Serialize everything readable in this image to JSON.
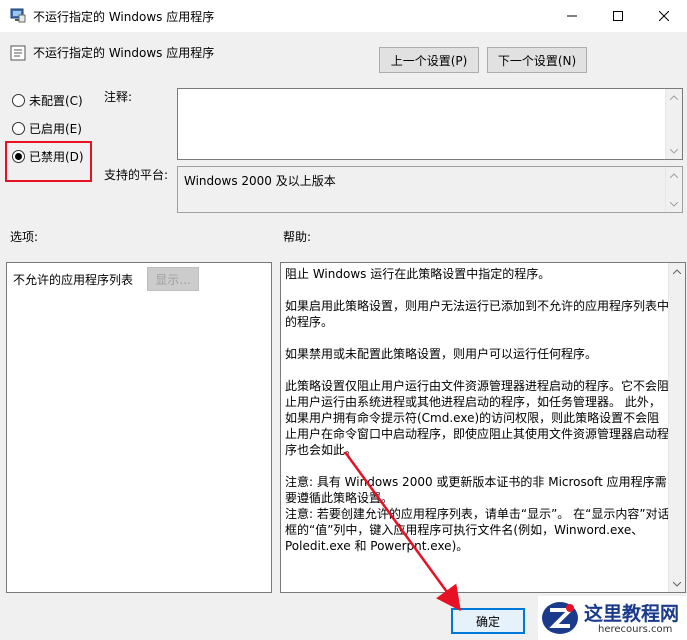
{
  "window": {
    "title": "不运行指定的 Windows 应用程序"
  },
  "header": {
    "policy_name": "不运行指定的 Windows 应用程序",
    "prev_setting": "上一个设置(P)",
    "next_setting": "下一个设置(N)"
  },
  "state": {
    "options": [
      {
        "label": "未配置(C)",
        "checked": false
      },
      {
        "label": "已启用(E)",
        "checked": false
      },
      {
        "label": "已禁用(D)",
        "checked": true
      }
    ],
    "highlight_color": "#e81123"
  },
  "comment": {
    "label": "注释:",
    "value": ""
  },
  "platform": {
    "label": "支持的平台:",
    "value": "Windows 2000 及以上版本"
  },
  "options_section": {
    "label": "选项:",
    "list_label": "不允许的应用程序列表",
    "show_button": "显示..."
  },
  "help_section": {
    "label": "帮助:",
    "paragraphs": [
      "阻止 Windows 运行在此策略设置中指定的程序。",
      "如果启用此策略设置，则用户无法运行已添加到不允许的应用程序列表中的程序。",
      "如果禁用或未配置此策略设置，则用户可以运行任何程序。",
      "此策略设置仅阻止用户运行由文件资源管理器进程启动的程序。它不会阻止用户运行由系统进程或其他进程启动的程序，如任务管理器。 此外，如果用户拥有命令提示符(Cmd.exe)的访问权限，则此策略设置不会阻止用户在命令窗口中启动程序，即使应阻止其使用文件资源管理器启动程序也会如此。",
      "注意: 具有 Windows 2000 或更新版本证书的非 Microsoft 应用程序需要遵循此策略设置。",
      "注意: 若要创建允许的应用程序列表，请单击“显示”。 在“显示内容”对话框的“值”列中，键入应用程序可执行文件名(例如，Winword.exe、Poledit.exe 和 Powerpnt.exe)。"
    ]
  },
  "footer": {
    "ok_button": "确定"
  },
  "watermark": {
    "name": "这里教程网",
    "url": "herecours.com"
  },
  "colors": {
    "accent": "#0078d7",
    "annotation_red": "#e81123",
    "watermark_blue": "#1a3a8c"
  }
}
